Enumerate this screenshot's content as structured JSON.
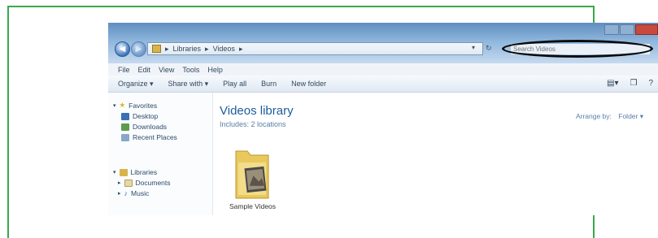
{
  "window": {
    "breadcrumb": [
      "Libraries",
      "Videos"
    ],
    "search_placeholder": "Search Videos"
  },
  "menu": [
    "File",
    "Edit",
    "View",
    "Tools",
    "Help"
  ],
  "toolbar": {
    "items": [
      "Organize ▾",
      "Share with ▾",
      "Play all",
      "Burn",
      "New folder"
    ]
  },
  "nav": {
    "favorites": {
      "label": "Favorites",
      "items": [
        "Desktop",
        "Downloads",
        "Recent Places"
      ]
    },
    "libraries": {
      "label": "Libraries",
      "items": [
        "Documents",
        "Music"
      ]
    }
  },
  "content": {
    "title": "Videos library",
    "subtitle": "Includes: 2 locations",
    "arrange_label": "Arrange by:",
    "arrange_value": "Folder ▾",
    "items": [
      {
        "label": "Sample Videos"
      }
    ]
  },
  "colors": {
    "frame": "#3aa84a",
    "accent": "#1e5b9e",
    "highlight_oval": "#0a0a0a"
  }
}
